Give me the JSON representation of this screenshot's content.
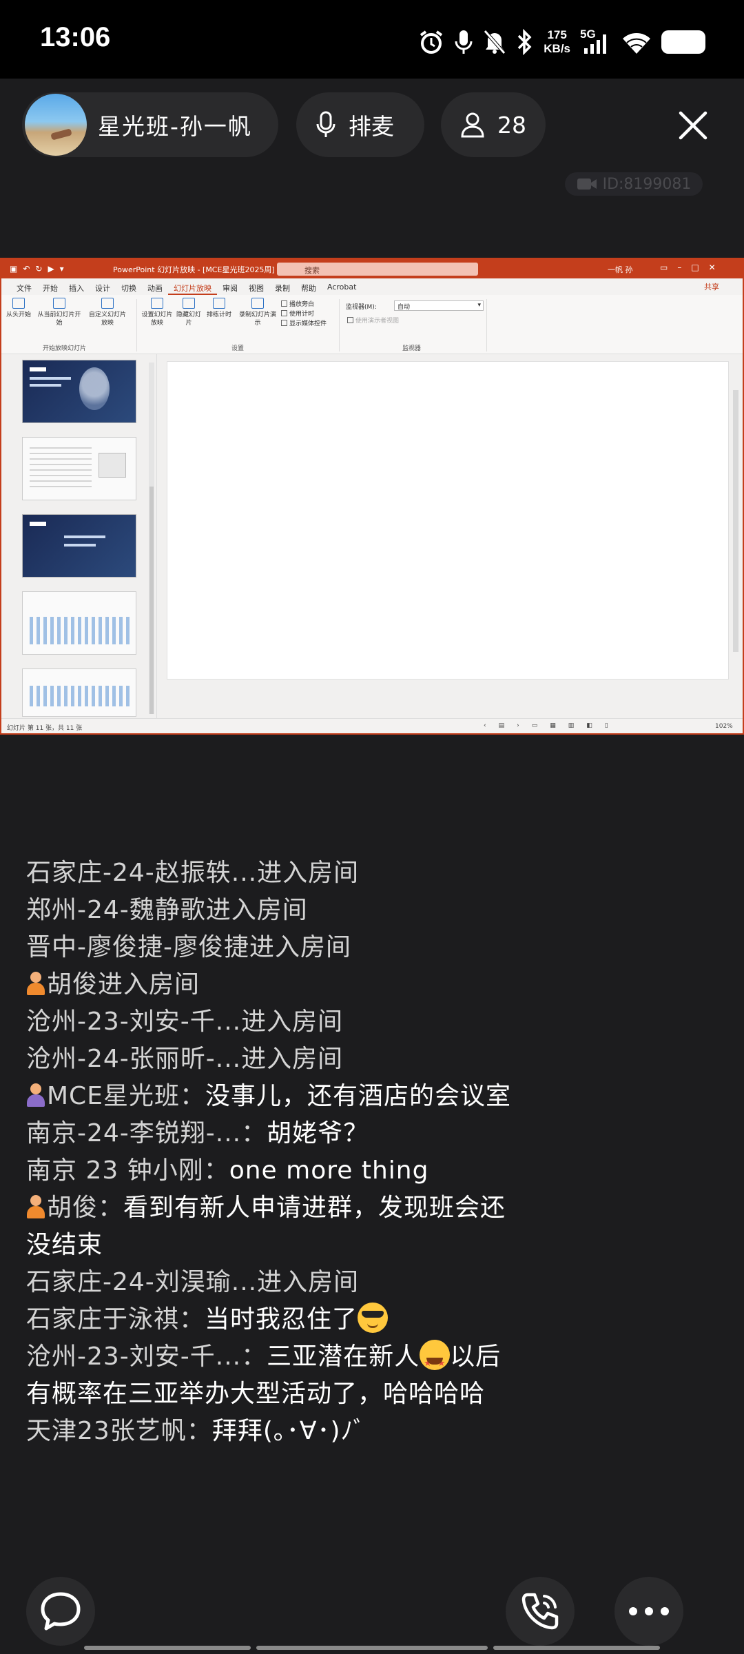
{
  "status_bar": {
    "time": "13:06",
    "net_speed_value": "175",
    "net_speed_unit": "KB/s",
    "network": "5G",
    "icons": [
      "alarm-icon",
      "mic-icon",
      "mute-icon",
      "bluetooth-icon",
      "signal-icon",
      "wifi-icon",
      "battery-icon"
    ]
  },
  "header": {
    "host_name": "星光班-孙一帆",
    "queue_label": "排麦",
    "viewer_count": "28",
    "room_id": "ID:8199081"
  },
  "ppt": {
    "title": "PowerPoint 幻灯片放映 - [MCE星光班2025周]",
    "search_placeholder": "搜索",
    "user": "一帆 孙",
    "menu": [
      "文件",
      "开始",
      "插入",
      "设计",
      "切换",
      "动画",
      "幻灯片放映",
      "审阅",
      "视图",
      "录制",
      "帮助",
      "Acrobat"
    ],
    "active_menu": "幻灯片放映",
    "share": "共享",
    "ribbon": {
      "from_start": "从头开始",
      "from_current": "从当前幻灯片开始",
      "custom_show": "自定义幻灯片放映",
      "group_start": "开始放映幻灯片",
      "setup_show": "设置幻灯片放映",
      "hide_slide": "隐藏幻灯片",
      "rehearse": "排练计时",
      "record": "录制幻灯片演示",
      "check_narration": "播放旁白",
      "check_timing": "使用计时",
      "check_media": "显示媒体控件",
      "group_setup": "设置",
      "monitor_label": "监视器(M):",
      "monitor_value": "自动",
      "presenter_view": "使用演示者视图",
      "group_monitor": "监视器"
    },
    "status_left": "幻灯片 第 11 张，共 11 张",
    "zoom": "102%"
  },
  "chat": [
    {
      "text": "石家庄-24-赵振轶...进入房间",
      "type": "join"
    },
    {
      "text": "郑州-24-魏静歌进入房间",
      "type": "join"
    },
    {
      "text": "晋中-廖俊捷-廖俊捷进入房间",
      "type": "join"
    },
    {
      "text": "胡俊进入房间",
      "type": "join",
      "avatar": "orange"
    },
    {
      "text": "沧州-23-刘安-千...进入房间",
      "type": "join"
    },
    {
      "text": "沧州-24-张丽昕-...进入房间",
      "type": "join"
    },
    {
      "name": "MCE星光班：",
      "text": "没事儿，还有酒店的会议室",
      "type": "comment",
      "avatar": "purple"
    },
    {
      "name": "南京-24-李锐翔-...：",
      "text": "胡姥爷？",
      "type": "comment"
    },
    {
      "name": "南京 23 钟小刚：",
      "text": "one more thing",
      "type": "comment"
    },
    {
      "name": "胡俊：",
      "text": "看到有新人申请进群，发现班会还没结束",
      "type": "comment",
      "avatar": "orange"
    },
    {
      "text": "石家庄-24-刘淏瑜...进入房间",
      "type": "join"
    },
    {
      "name": "石家庄于泳祺：",
      "text": "当时我忍住了",
      "type": "comment",
      "emoji": "cool"
    },
    {
      "name": "沧州-23-刘安-千...：",
      "text": "三亚潜在新人",
      "text2": "以后有概率在三亚举办大型活动了，哈哈哈哈",
      "type": "comment",
      "emoji": "star"
    },
    {
      "name": "天津23张艺帆：",
      "text": "拜拜(｡･∀･)ﾉﾞ",
      "type": "comment"
    }
  ],
  "bottom_bar": {
    "icons": [
      "chat-bubble-icon",
      "phone-icon",
      "more-icon"
    ]
  }
}
